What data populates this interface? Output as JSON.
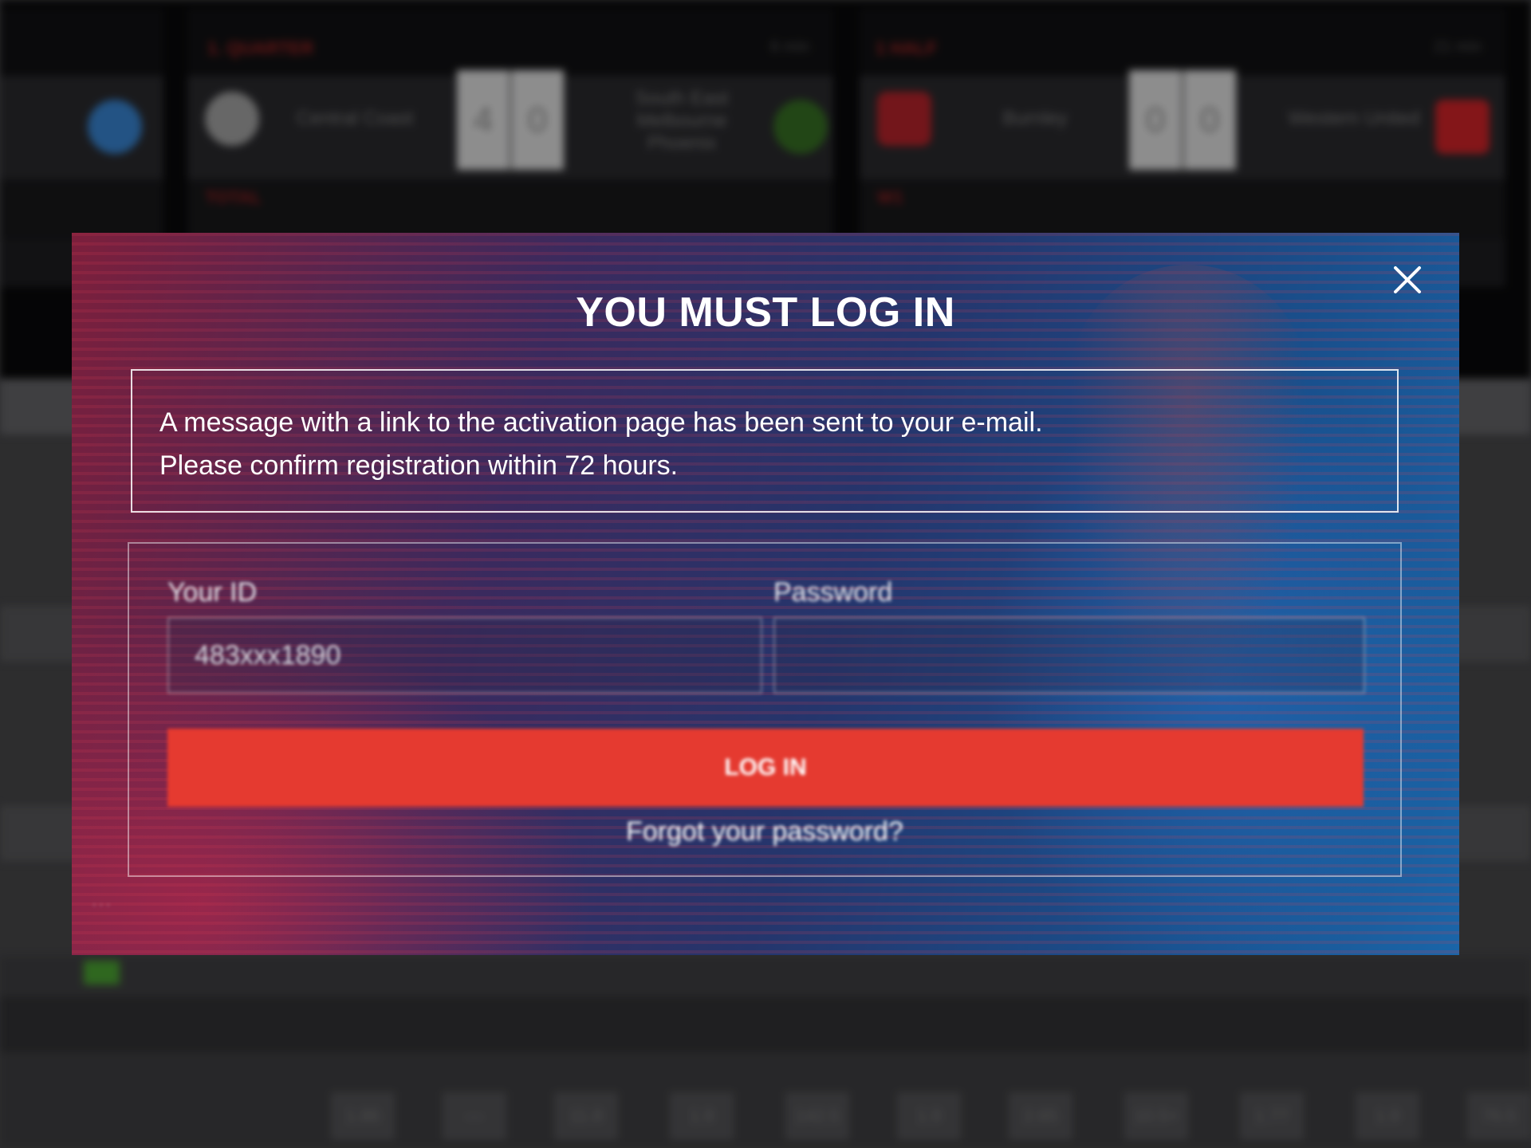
{
  "modal": {
    "title": "YOU MUST LOG IN",
    "notice_line1": "A message with a link to the activation page has been sent to your e-mail.",
    "notice_line2": "Please confirm registration within 72 hours.",
    "id_label": "Your ID",
    "id_value": "483xxx1890",
    "password_label": "Password",
    "password_value": "",
    "login_button": "LOG IN",
    "forgot_link": "Forgot your password?",
    "close_icon": "close-icon"
  },
  "background": {
    "matches": [
      {
        "league": "1. QUARTER",
        "time": "6 min",
        "home_team": "Central Coast",
        "away_team": "South East Melbourne Phoenix",
        "home_score": "4",
        "away_score": "0",
        "odds_label": "TOTAL"
      },
      {
        "league": "1 HALF",
        "time": "21 min",
        "home_team": "Burnley",
        "away_team": "Western United",
        "home_score": "0",
        "away_score": "0",
        "odds_label": "W1"
      }
    ],
    "odds": [
      "1.86",
      "—",
      "11.8",
      "1.9",
      "142.5",
      "1.9",
      "2.65",
      "10.5+",
      "1.77",
      "1.9",
      "76.5"
    ]
  },
  "colors": {
    "accent_red": "#e53a30",
    "modal_gradient_left": "#7c1f3c",
    "modal_gradient_right": "#1a65a8"
  }
}
